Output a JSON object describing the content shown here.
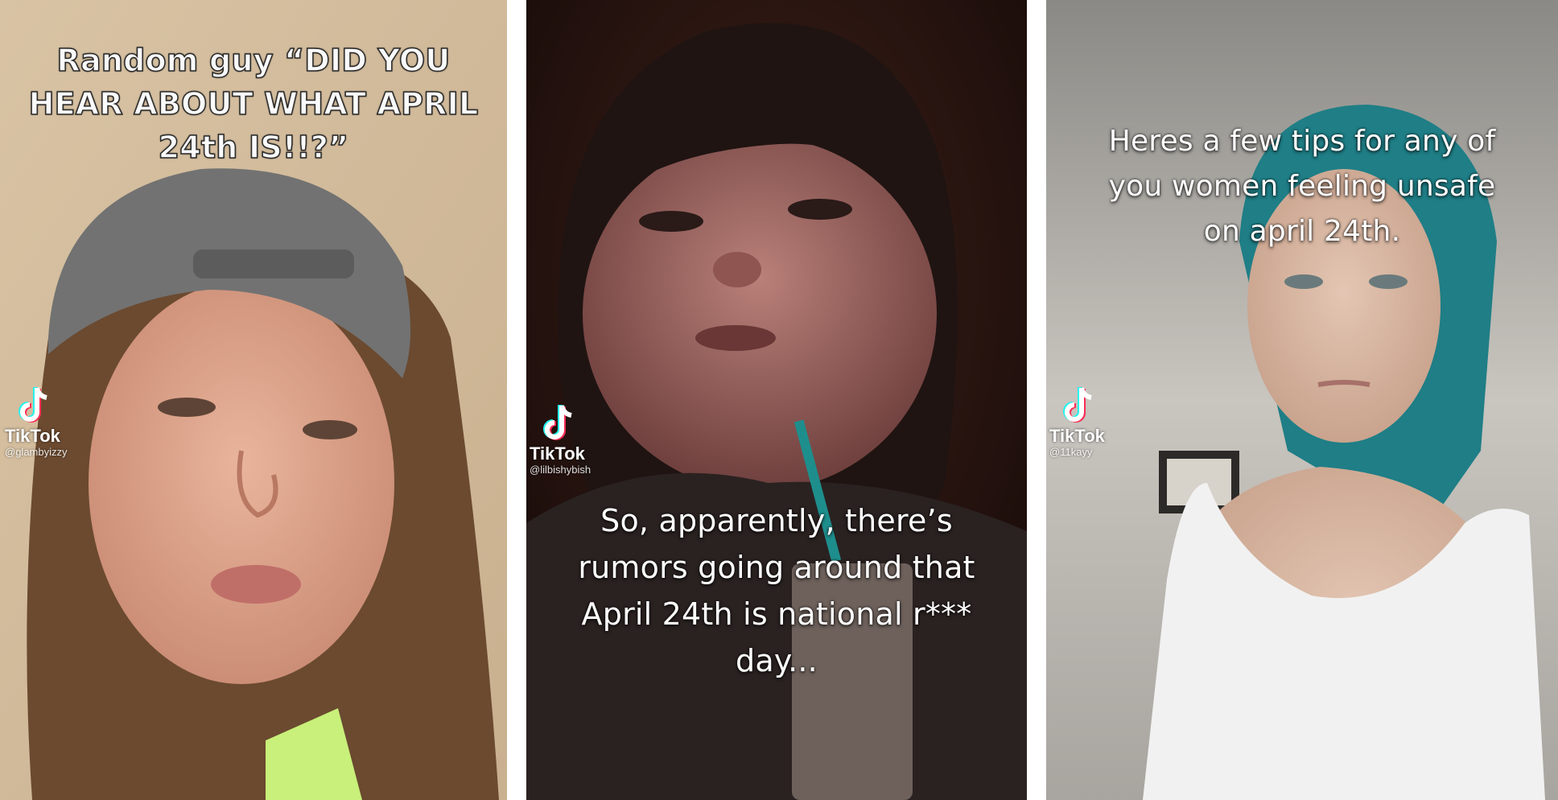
{
  "panels": [
    {
      "caption": "Random guy “DID YOU\nHEAR ABOUT WHAT APRIL\n24th IS!!?”",
      "watermark": {
        "brand": "TikTok",
        "username": "@glambyizzy"
      }
    },
    {
      "caption": "So, apparently, there’s\nrumors going around that\nApril 24th is national r***\nday...",
      "watermark": {
        "brand": "TikTok",
        "username": "@lilbishybish"
      }
    },
    {
      "caption": "Heres a few tips for any of\nyou women feeling unsafe\non april 24th.",
      "watermark": {
        "brand": "TikTok",
        "username": "@11kayy"
      }
    }
  ],
  "icons": {
    "watermark_logo": "tiktok-logo-icon"
  },
  "colors": {
    "divider": "#ffffff",
    "tiktok_cyan": "#25F4EE",
    "tiktok_red": "#FE2C55"
  }
}
